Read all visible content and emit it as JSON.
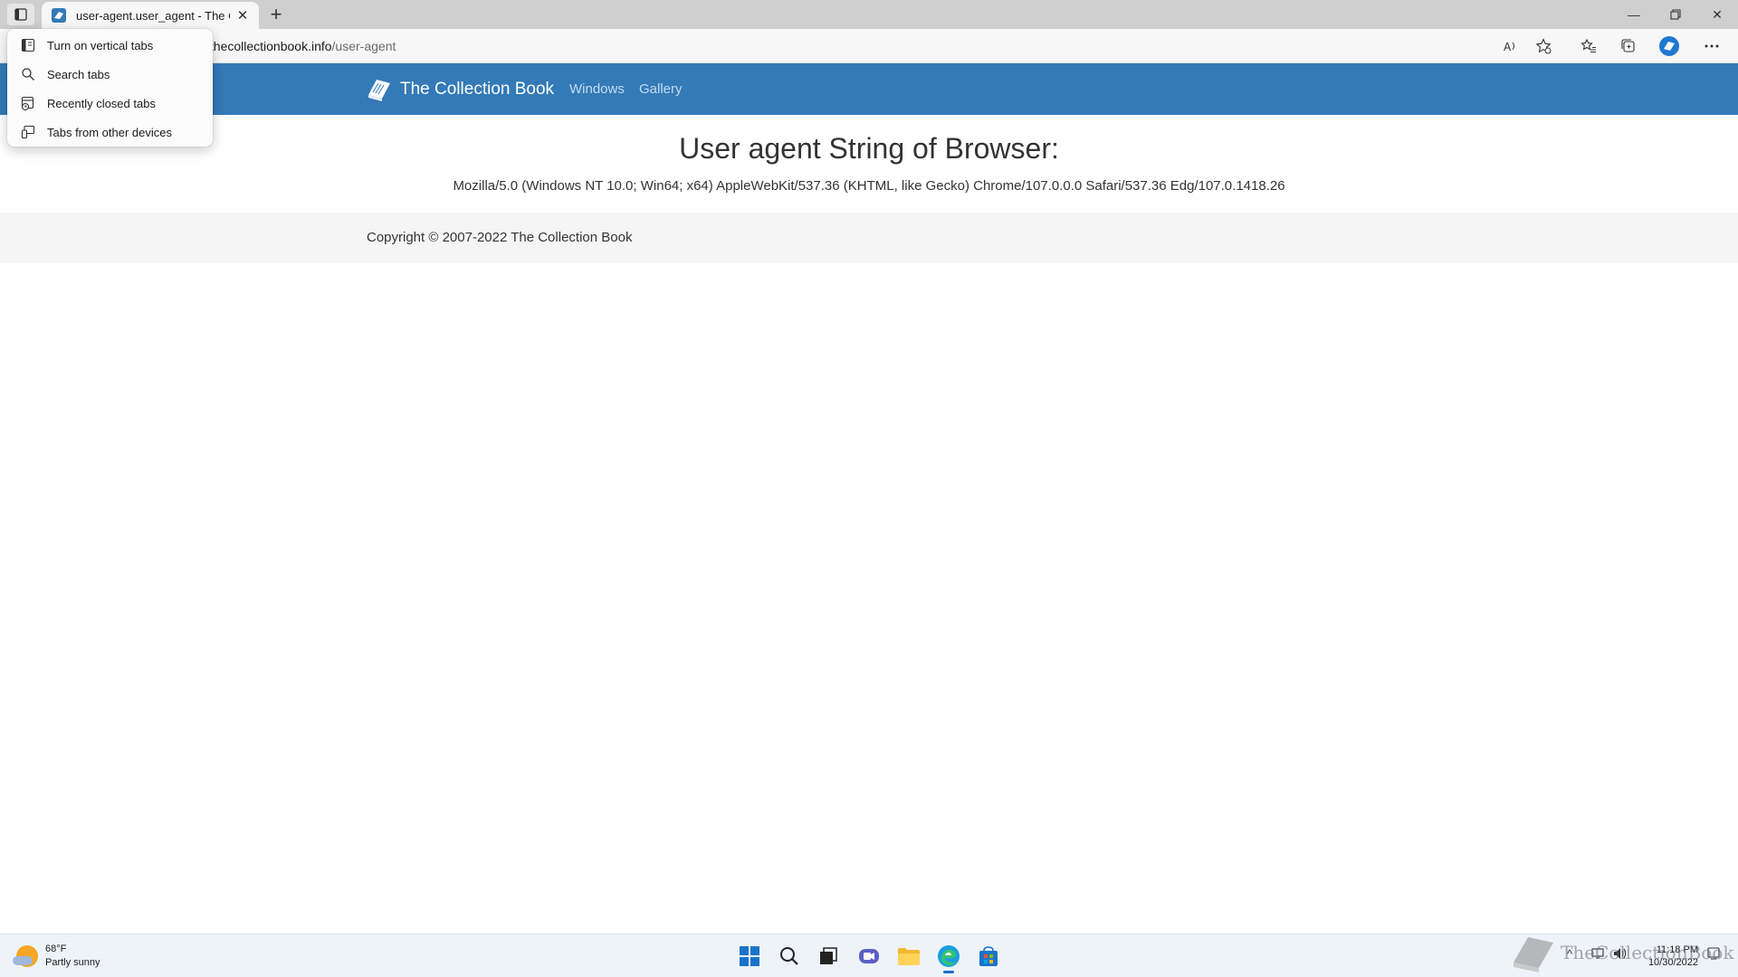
{
  "browser": {
    "tab": {
      "title": "user-agent.user_agent - The Collection Book"
    },
    "address": {
      "host": "thecollectionbook.info",
      "path": "/user-agent",
      "prefix": "/"
    }
  },
  "tab_menu": {
    "items": [
      {
        "label": "Turn on vertical tabs",
        "icon": "vertical-tabs-icon"
      },
      {
        "label": "Search tabs",
        "icon": "search-icon"
      },
      {
        "label": "Recently closed tabs",
        "icon": "recently-closed-icon"
      },
      {
        "label": "Tabs from other devices",
        "icon": "other-devices-icon"
      }
    ]
  },
  "site": {
    "brand": "The Collection Book",
    "nav": [
      "Windows",
      "Gallery"
    ],
    "heading": "User agent String of Browser:",
    "user_agent": "Mozilla/5.0 (Windows NT 10.0; Win64; x64) AppleWebKit/537.36 (KHTML, like Gecko) Chrome/107.0.0.0 Safari/537.36 Edg/107.0.1418.26",
    "footer": "Copyright © 2007-2022 The Collection Book",
    "colors": {
      "navbar": "#337ab7",
      "nav_link": "#c5dcf0",
      "footer_bg": "#f5f5f5"
    }
  },
  "taskbar": {
    "weather": {
      "temp": "68°F",
      "condition": "Partly sunny"
    },
    "clock": {
      "time": "11:18 PM",
      "date": "10/30/2022"
    },
    "watermark": "TheCollectionBook"
  }
}
